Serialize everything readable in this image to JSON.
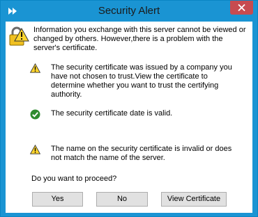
{
  "window": {
    "title": "Security Alert",
    "accent_color": "#1a94d3",
    "close_color": "#c74b50"
  },
  "header": {
    "icon": "lock-warning-icon",
    "text": "Information you exchange with this server cannot be viewed or changed by others. However,there is a problem with the server's certificate."
  },
  "items": [
    {
      "icon": "warning-icon",
      "text": "The security certificate was issued by a company you have not chosen to trust.View the certificate to determine whether you want to trust the certifying authority."
    },
    {
      "icon": "checkmark-icon",
      "text": "The security certificate date is valid."
    },
    {
      "icon": "warning-icon",
      "text": "The name on the security certificate is invalid or does not match the name of the server."
    }
  ],
  "question": "Do you want to proceed?",
  "buttons": {
    "yes": "Yes",
    "no": "No",
    "view_certificate": "View Certificate"
  }
}
